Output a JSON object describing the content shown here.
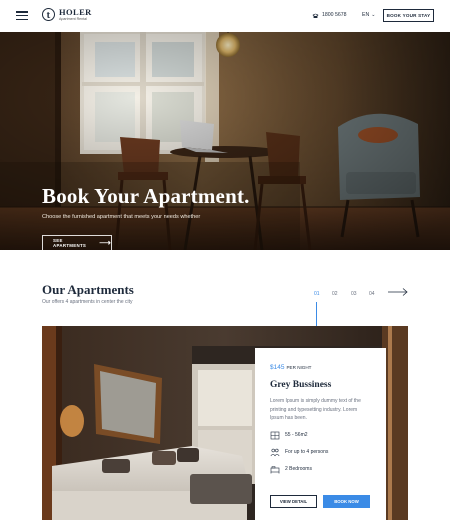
{
  "header": {
    "logo_letter": "t",
    "logo_name": "HOLER",
    "logo_tagline": "Apartment Rental",
    "phone": "1800 5678",
    "language": "EN",
    "book_button": "BOOK YOUR STAY"
  },
  "hero": {
    "title": "Book Your Apartment.",
    "subtitle": "Choose the furnished apartment that meets your needs whether",
    "button": "SEE APARTMENTS"
  },
  "apartments": {
    "title": "Our Apartments",
    "subtitle": "Our offers 4 apartments in center the city",
    "pages": [
      "01",
      "02",
      "03",
      "04"
    ],
    "active_page": "01"
  },
  "card": {
    "price": "$145",
    "price_unit": "PER NIGHT",
    "title": "Grey Bussiness",
    "description": "Lorem Ipsum is simply dummy text of the printing and typesetting industry. Lorem Ipsum has been.",
    "features": [
      {
        "icon": "area-icon",
        "text": "55 - 56m2"
      },
      {
        "icon": "persons-icon",
        "text": "For up to 4 persons"
      },
      {
        "icon": "bed-icon",
        "text": "2 Bedrooms"
      }
    ],
    "view_button": "VIEW DETAIL",
    "book_button": "BOOK NOW"
  },
  "colors": {
    "accent": "#3b8be6",
    "navy": "#1e2a3b"
  }
}
